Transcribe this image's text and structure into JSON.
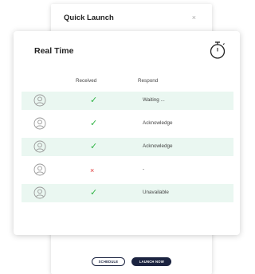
{
  "back_dialog": {
    "title": "Quick Launch",
    "close_glyph": "×",
    "schedule_label": "SCHEDULE",
    "launch_label": "LAUNCH NOW"
  },
  "front_dialog": {
    "title": "Real Time",
    "timer_icon": "stopwatch-icon",
    "headers": {
      "received": "Received",
      "respond": "Respond"
    },
    "rows": [
      {
        "received": "ok",
        "received_glyph": "✓",
        "respond": "Waiting ..."
      },
      {
        "received": "ok",
        "received_glyph": "✓",
        "respond": "Acknowledge"
      },
      {
        "received": "ok",
        "received_glyph": "✓",
        "respond": "Acknowledge"
      },
      {
        "received": "bad",
        "received_glyph": "×",
        "respond": "-"
      },
      {
        "received": "ok",
        "received_glyph": "✓",
        "respond": "Unavailable"
      }
    ]
  },
  "colors": {
    "accent_dark": "#1b2340",
    "ok": "#2fb344",
    "bad": "#e03a3a",
    "row_shade": "#eaf7f1"
  }
}
